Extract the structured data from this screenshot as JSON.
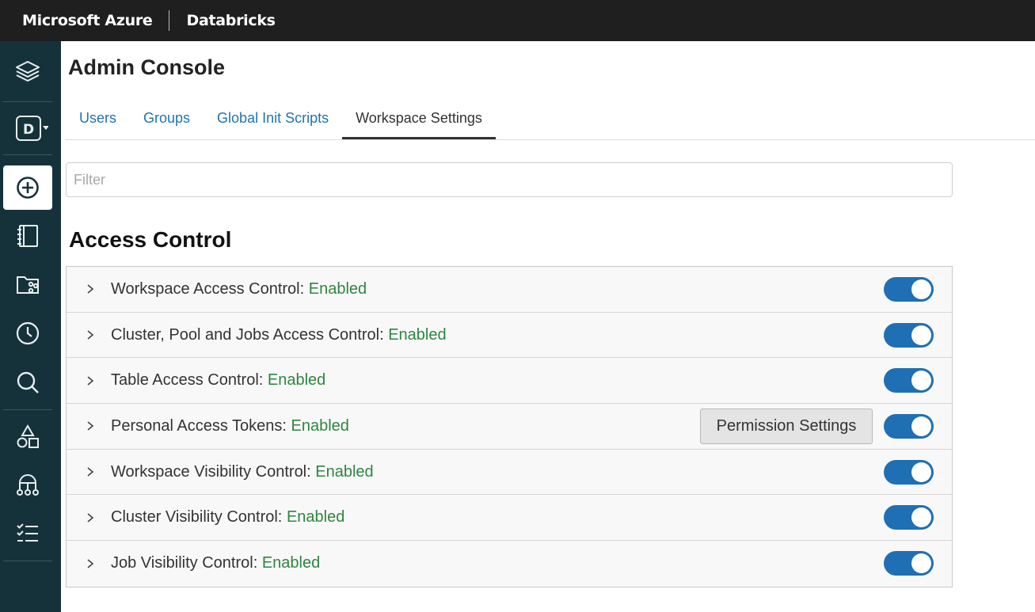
{
  "topbar": {
    "brand": "Microsoft Azure",
    "product": "Databricks"
  },
  "sidebar": {
    "items": [
      {
        "icon": "layers-icon"
      },
      {
        "icon": "workspace-letter-icon",
        "letter": "D"
      },
      {
        "icon": "create-plus-icon"
      },
      {
        "icon": "notebook-icon"
      },
      {
        "icon": "repos-icon"
      },
      {
        "icon": "recents-clock-icon"
      },
      {
        "icon": "search-icon"
      },
      {
        "icon": "shapes-icon"
      },
      {
        "icon": "hierarchy-icon"
      },
      {
        "icon": "checklist-icon"
      }
    ]
  },
  "page": {
    "title": "Admin Console"
  },
  "tabs": [
    {
      "label": "Users",
      "active": false
    },
    {
      "label": "Groups",
      "active": false
    },
    {
      "label": "Global Init Scripts",
      "active": false
    },
    {
      "label": "Workspace Settings",
      "active": true
    }
  ],
  "filter": {
    "placeholder": "Filter",
    "value": ""
  },
  "section": {
    "title": "Access Control"
  },
  "settings": [
    {
      "label": "Workspace Access Control: ",
      "status": "Enabled",
      "enabled": true
    },
    {
      "label": "Cluster, Pool and Jobs Access Control: ",
      "status": "Enabled",
      "enabled": true
    },
    {
      "label": "Table Access Control: ",
      "status": "Enabled",
      "enabled": true
    },
    {
      "label": "Personal Access Tokens: ",
      "status": "Enabled",
      "enabled": true,
      "button": "Permission Settings"
    },
    {
      "label": "Workspace Visibility Control: ",
      "status": "Enabled",
      "enabled": true
    },
    {
      "label": "Cluster Visibility Control: ",
      "status": "Enabled",
      "enabled": true
    },
    {
      "label": "Job Visibility Control: ",
      "status": "Enabled",
      "enabled": true
    }
  ],
  "colors": {
    "topbar": "#1f1f1f",
    "sidebar": "#15323b",
    "link": "#1f73b7",
    "enabled": "#2e8540",
    "toggle": "#1f6fb4"
  }
}
